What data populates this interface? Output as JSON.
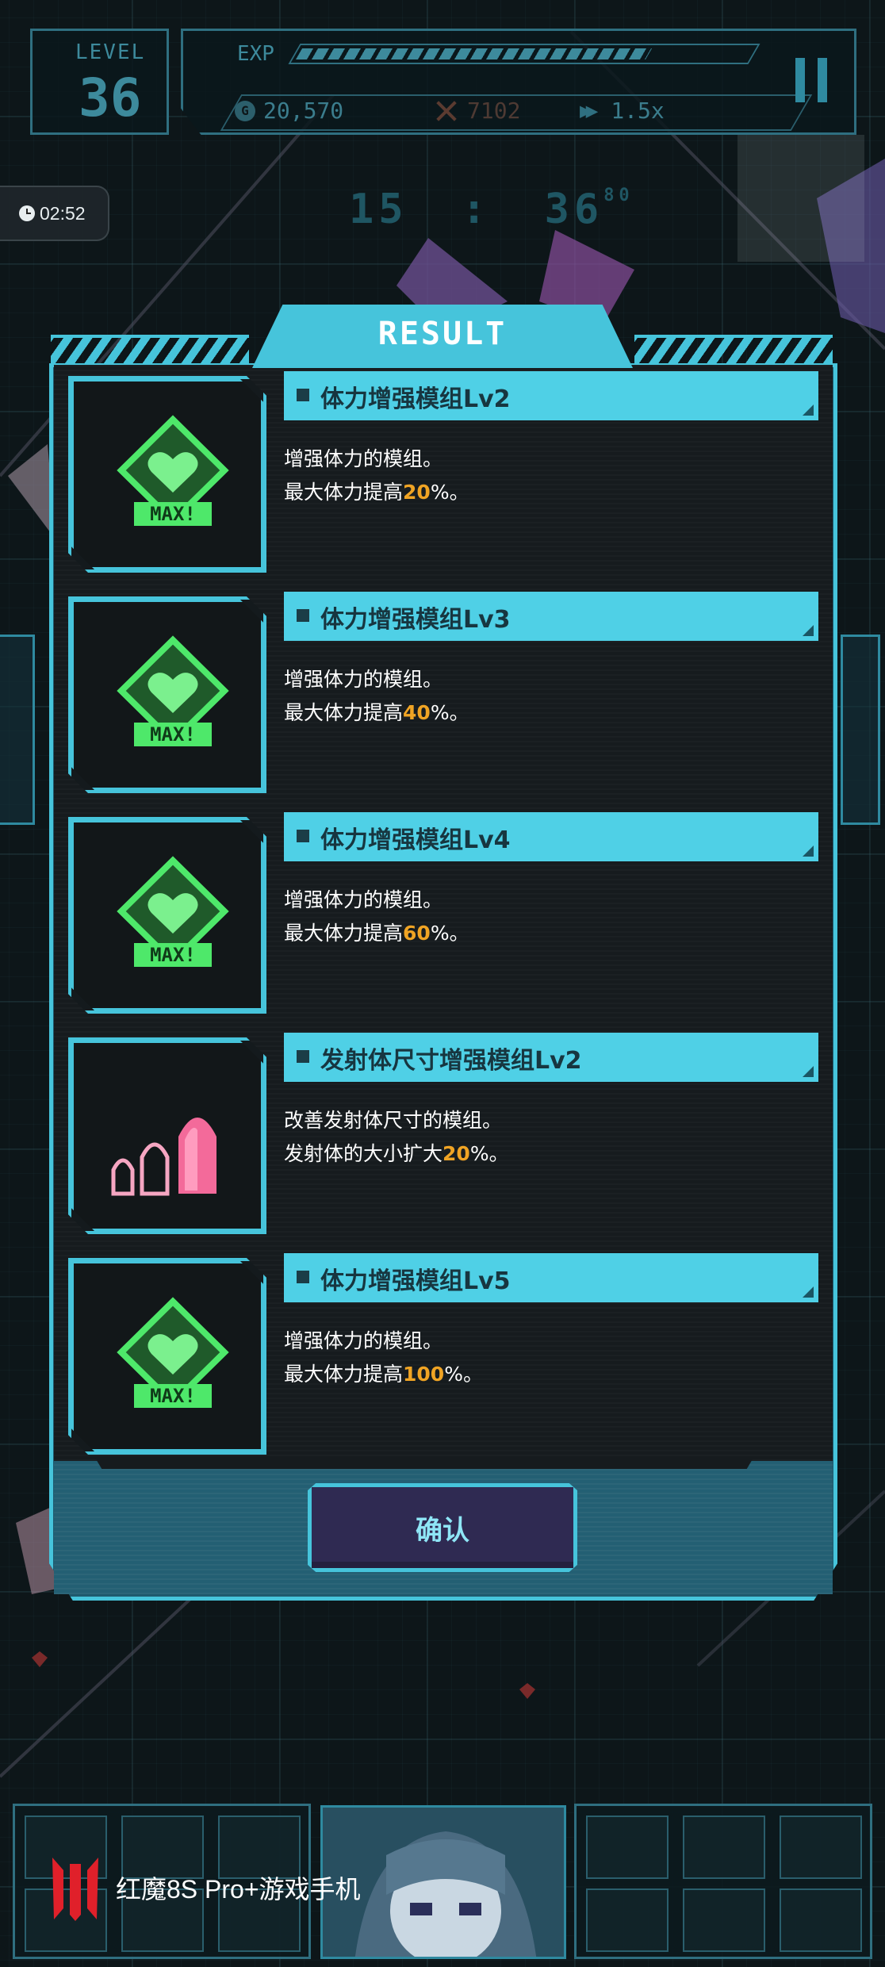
{
  "hud": {
    "level_label": "LEVEL",
    "level_value": "36",
    "exp_label": "EXP",
    "exp_progress": 0.78,
    "gold_value": "20,570",
    "kills_value": "7102",
    "speed_value": "1.5x"
  },
  "session_timer": "02:52",
  "game_clock": {
    "minutes": "15",
    "separator": ":",
    "seconds": "36",
    "fraction": "80"
  },
  "result": {
    "title": "RESULT",
    "modules": [
      {
        "name": "体力增强模组Lv2",
        "desc_line1": "增强体力的模组。",
        "desc_prefix": "最大体力提高",
        "desc_value": "20",
        "desc_suffix": "%。",
        "icon": "heart-max-icon"
      },
      {
        "name": "体力增强模组Lv3",
        "desc_line1": "增强体力的模组。",
        "desc_prefix": "最大体力提高",
        "desc_value": "40",
        "desc_suffix": "%。",
        "icon": "heart-max-icon"
      },
      {
        "name": "体力增强模组Lv4",
        "desc_line1": "增强体力的模组。",
        "desc_prefix": "最大体力提高",
        "desc_value": "60",
        "desc_suffix": "%。",
        "icon": "heart-max-icon"
      },
      {
        "name": "发射体尺寸增强模组Lv2",
        "desc_line1": "改善发射体尺寸的模组。",
        "desc_prefix": "发射体的大小扩大",
        "desc_value": "20",
        "desc_suffix": "%。",
        "icon": "bullet-size-icon"
      },
      {
        "name": "体力增强模组Lv5",
        "desc_line1": "增强体力的模组。",
        "desc_prefix": "最大体力提高",
        "desc_value": "100",
        "desc_suffix": "%。",
        "icon": "heart-max-icon"
      }
    ],
    "confirm_label": "确认"
  },
  "max_badge": "MAX!",
  "brand": {
    "label": "红魔8S Pro+游戏手机"
  },
  "colors": {
    "accent": "#46c4db",
    "header": "#4fd0e6",
    "highlight": "#f0a424",
    "heart_green": "#4ee86a",
    "bullet_pink": "#f36a9a"
  }
}
